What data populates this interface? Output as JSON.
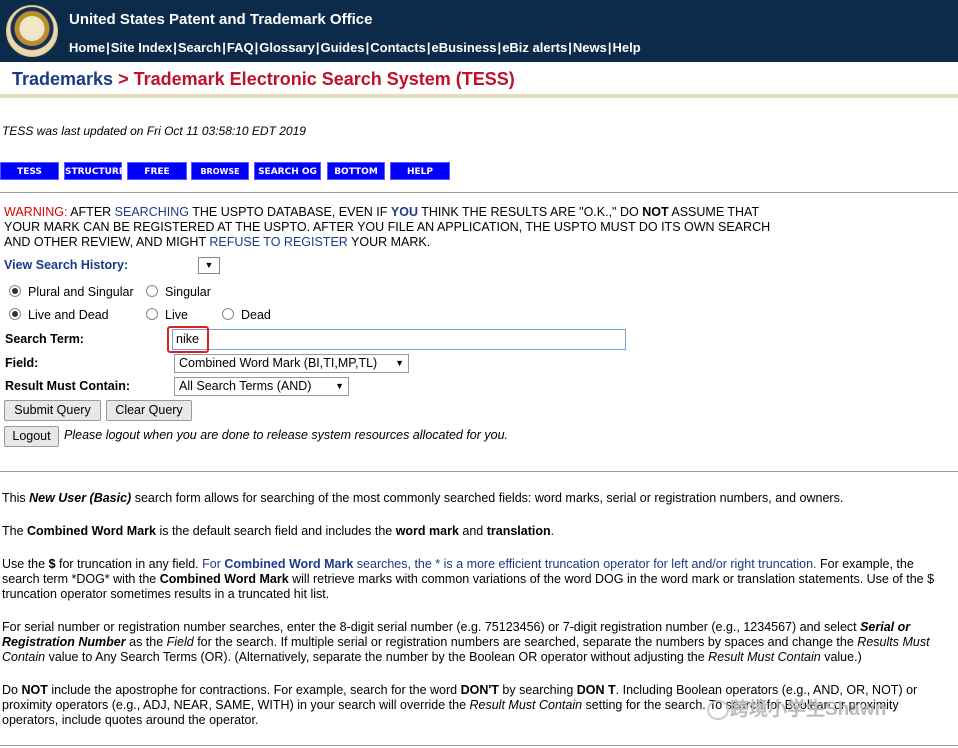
{
  "header": {
    "org": "United States Patent and Trademark Office",
    "nav": [
      "Home",
      "Site Index",
      "Search",
      "FAQ",
      "Glossary",
      "Guides",
      "Contacts",
      "eBusiness",
      "eBiz alerts",
      "News",
      "Help"
    ]
  },
  "breadcrumb": {
    "parent": "Trademarks",
    "separator": ">",
    "current": "Trademark Electronic Search System (TESS)"
  },
  "updated": "TESS was last updated on Fri Oct 11 03:58:10 EDT 2019",
  "toolbar": [
    "TESS HOME",
    "STRUCTURED",
    "FREE FORM",
    "BROWSE DICT",
    "SEARCH OG",
    "BOTTOM",
    "HELP"
  ],
  "warning": {
    "label": "WARNING:",
    "text1": " AFTER ",
    "searching": "SEARCHING",
    "text2": " THE USPTO DATABASE, EVEN IF ",
    "you": "YOU",
    "text3": " THINK THE RESULTS ARE \"O.K.,\" DO ",
    "not": "NOT",
    "text4": " ASSUME THAT YOUR MARK CAN BE REGISTERED AT THE USPTO. AFTER YOU FILE AN APPLICATION, THE USPTO MUST DO ITS OWN SEARCH AND OTHER REVIEW, AND MIGHT ",
    "refuse": "REFUSE TO REGISTER",
    "text5": " YOUR MARK."
  },
  "form": {
    "history_label": "View Search History:",
    "plural": "Plural and Singular",
    "singular": "Singular",
    "live_dead": "Live and Dead",
    "live": "Live",
    "dead": "Dead",
    "term_label": "Search Term:",
    "term_value": "nike",
    "field_label": "Field:",
    "field_value": "Combined Word Mark (BI,TI,MP,TL)",
    "contain_label": "Result Must Contain:",
    "contain_value": "All Search Terms (AND)",
    "submit": "Submit Query",
    "clear": "Clear Query",
    "logout": "Logout",
    "logout_note": "Please logout when you are done to release system resources allocated for you."
  },
  "help": {
    "p1a": "This ",
    "p1b": "New User (Basic)",
    "p1c": " search form allows for searching of the most commonly searched fields: word marks, serial or registration numbers, and owners.",
    "p2a": "The ",
    "p2b": "Combined Word Mark",
    "p2c": " is the default search field and includes the ",
    "p2d": "word mark",
    "p2e": " and ",
    "p2f": "translation",
    "p2g": ".",
    "p3a": "Use the ",
    "p3b": "$",
    "p3c": " for truncation in any field. ",
    "p3d": "For ",
    "p3e": "Combined Word Mark",
    "p3f": " searches, the * is a more efficient truncation operator for left and/or right truncation.",
    "p3g": " For example, the search term *DOG* with the ",
    "p3h": "Combined Word Mark",
    "p3i": " will retrieve marks with common variations of the word DOG in the word mark or translation statements. Use of the $ truncation operator sometimes results in a truncated hit list.",
    "p4a": "For serial number or registration number searches, enter the 8-digit serial number (e.g. 75123456) or 7-digit registration number (e.g., 1234567) and select ",
    "p4b": "Serial or Registration Number",
    "p4c": " as the ",
    "p4d": "Field",
    "p4e": " for the search. If multiple serial or registration numbers are searched, separate the numbers by spaces and change the ",
    "p4f": "Results Must Contain",
    "p4g": " value to Any Search Terms (OR). (Alternatively, separate the number by the Boolean OR operator without adjusting the ",
    "p4h": "Result Must Contain",
    "p4i": " value.)",
    "p5a": "Do ",
    "p5b": "NOT",
    "p5c": " include the apostrophe for contractions. For example, search for the word ",
    "p5d": "DON'T",
    "p5e": " by searching ",
    "p5f": "DON T",
    "p5g": ". Including Boolean operators (e.g., AND, OR, NOT) or proximity operators (e.g., ADJ, NEAR, SAME, WITH) in your search will override the ",
    "p5h": "Result Must Contain",
    "p5i": " setting for the search. To search for Boolean or proximity operators, include quotes around the operator."
  },
  "watermark": "跨境小学生Shawn"
}
